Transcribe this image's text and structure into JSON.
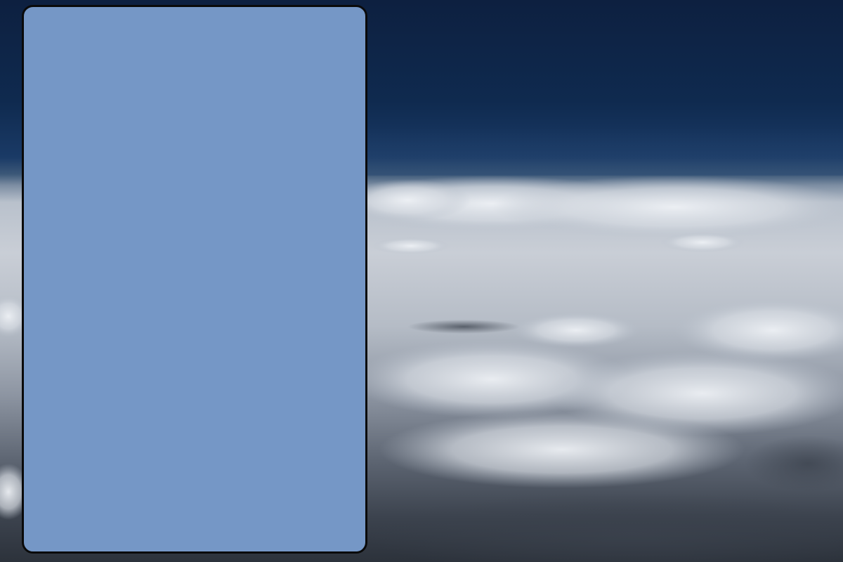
{
  "wallpaper": {
    "icon": "clouds-landscape",
    "sky_color": "#0f2a4f",
    "cloud_color": "#c9ced6"
  },
  "panel": {
    "fill_color": "#7597c6",
    "border_color": "#0a0a0a"
  }
}
